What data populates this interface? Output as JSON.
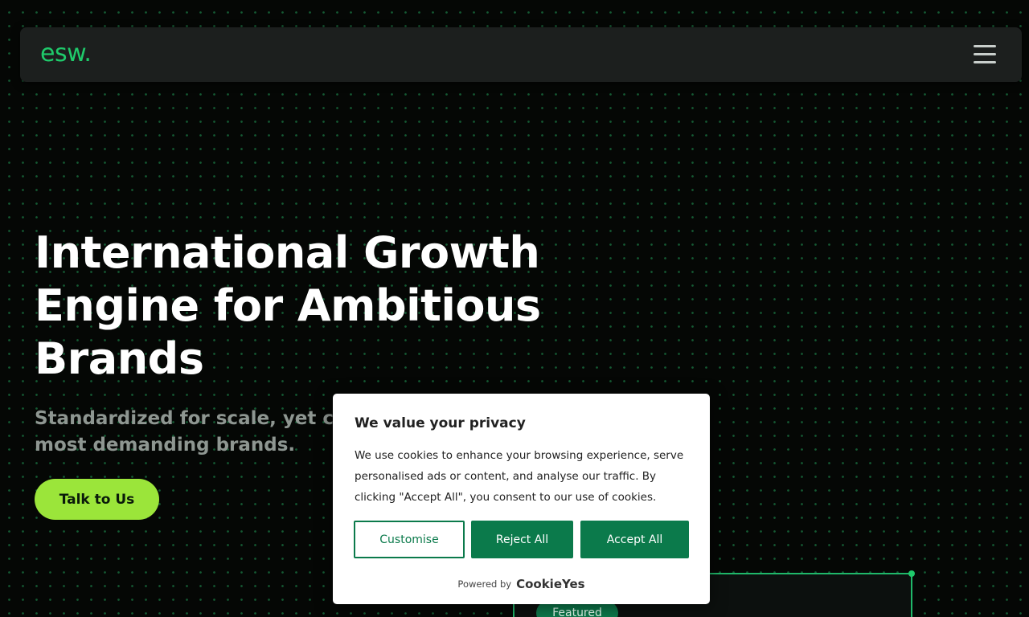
{
  "nav": {
    "logo": "esw.",
    "menu_icon": "hamburger-menu-icon"
  },
  "hero": {
    "title_lines": [
      "International Growth",
      "Engine for Ambitious",
      "Brands"
    ],
    "subtitle_lines": [
      "Standardized for scale, yet cor",
      "most demanding brands."
    ],
    "cta_label": "Talk to Us"
  },
  "card": {
    "badge": "Featured"
  },
  "cookie_banner": {
    "title": "We value your privacy",
    "text": "We use cookies to enhance your browsing experience, serve personalised ads or content, and analyse our traffic. By clicking \"Accept All\", you consent to our use of cookies.",
    "customise_label": "Customise",
    "reject_label": "Reject All",
    "accept_label": "Accept All",
    "powered_by_label": "Powered by",
    "powered_by_brand": "CookieYes"
  },
  "colors": {
    "background": "#050705",
    "brand_green": "#1fca6b",
    "cta_lime": "#9be53a",
    "button_green": "#0b7a4b"
  }
}
